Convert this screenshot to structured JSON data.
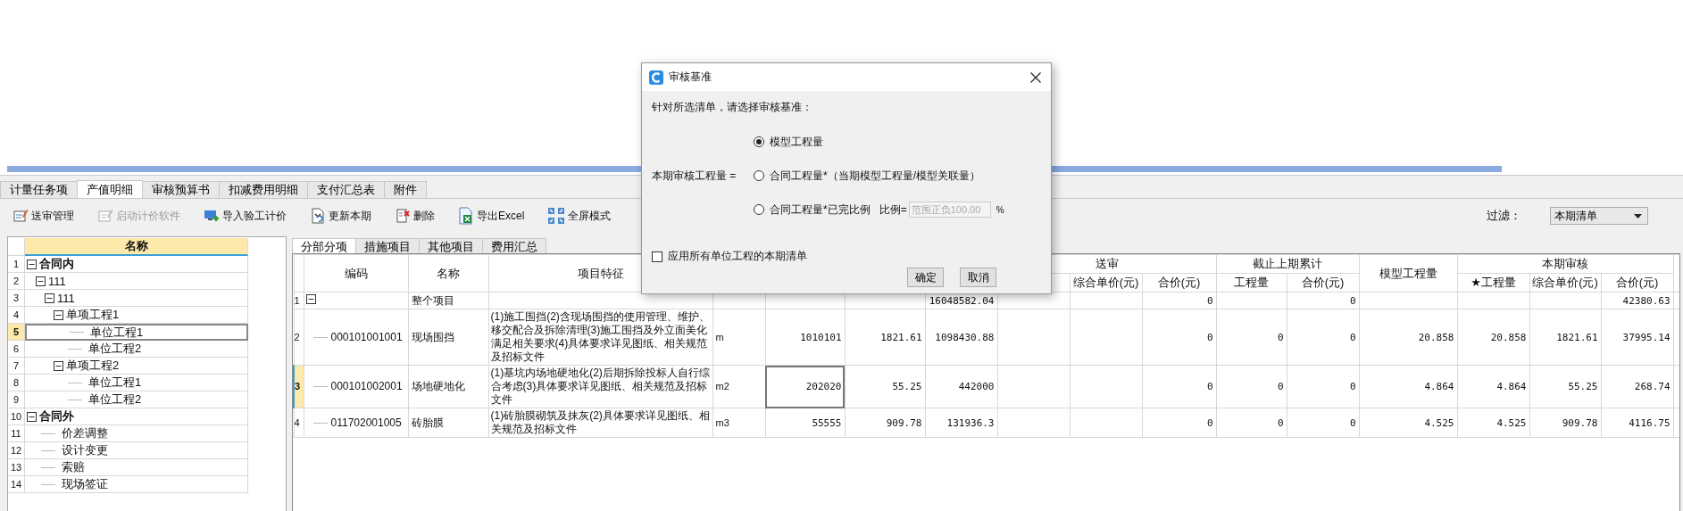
{
  "tabs": [
    {
      "label": "计量任务项",
      "selected": false
    },
    {
      "label": "产值明细",
      "selected": true
    },
    {
      "label": "审核预算书",
      "selected": false
    },
    {
      "label": "扣减费用明细",
      "selected": false
    },
    {
      "label": "支付汇总表",
      "selected": false
    },
    {
      "label": "附件",
      "selected": false
    }
  ],
  "toolbar": [
    {
      "label": "送审管理",
      "disabled": false
    },
    {
      "label": "启动计价软件",
      "disabled": true
    },
    {
      "label": "导入验工计价",
      "disabled": false
    },
    {
      "label": "更新本期",
      "disabled": false
    },
    {
      "label": "删除",
      "disabled": false
    },
    {
      "label": "导出Excel",
      "disabled": false
    },
    {
      "label": "全屏模式",
      "disabled": false
    }
  ],
  "filter": {
    "label": "过滤：",
    "value": "本期清单"
  },
  "tree": {
    "header": "名称",
    "items": [
      {
        "number": "1",
        "label": "合同内",
        "expanded": true,
        "selected": false,
        "children": [
          {
            "number": "2",
            "label": "111",
            "expanded": true,
            "selected": false,
            "children": [
              {
                "number": "3",
                "label": "111",
                "expanded": true,
                "selected": false,
                "children": [
                  {
                    "number": "4",
                    "label": "单项工程1",
                    "expanded": true,
                    "selected": false,
                    "children": [
                      {
                        "number": "5",
                        "label": "单位工程1",
                        "selected": true
                      },
                      {
                        "number": "6",
                        "label": "单位工程2",
                        "selected": false
                      }
                    ]
                  },
                  {
                    "number": "7",
                    "label": "单项工程2",
                    "expanded": true,
                    "selected": false,
                    "children": [
                      {
                        "number": "8",
                        "label": "单位工程1",
                        "selected": false
                      },
                      {
                        "number": "9",
                        "label": "单位工程2",
                        "selected": false
                      }
                    ]
                  }
                ]
              }
            ]
          }
        ]
      },
      {
        "number": "10",
        "label": "合同外",
        "expanded": true,
        "selected": false,
        "children": [
          {
            "number": "11",
            "label": "价差调整",
            "selected": false
          },
          {
            "number": "12",
            "label": "设计变更",
            "selected": false
          },
          {
            "number": "13",
            "label": "索赔",
            "selected": false
          },
          {
            "number": "14",
            "label": "现场签证",
            "selected": false
          }
        ]
      }
    ]
  },
  "subtabs": [
    {
      "label": "分部分项",
      "selected": true
    },
    {
      "label": "措施项目",
      "selected": false
    },
    {
      "label": "其他项目",
      "selected": false
    },
    {
      "label": "费用汇总",
      "selected": false
    }
  ],
  "table": {
    "columns": [
      {
        "label": "编码"
      },
      {
        "label": "名称"
      },
      {
        "label": "项目特征"
      },
      {
        "label": "送审",
        "sub": [
          "综合单价(元)",
          "合价(元)"
        ]
      },
      {
        "label": "截止上期累计",
        "sub": [
          "工程量",
          "合价(元)"
        ]
      },
      {
        "label": "模型工程量"
      },
      {
        "label": "本期审核",
        "sub": [
          "★工程量",
          "综合单价(元)",
          "合价(元)"
        ]
      }
    ],
    "rows": [
      {
        "number": "1",
        "name": "整个项目",
        "expanded": true,
        "selected": false,
        "total": "16048582.04",
        "submitted_total": "0",
        "prior_total": "0",
        "review_total": "42380.63",
        "children": [
          {
            "number": "2",
            "code": "000101001001",
            "name": "现场围挡",
            "features": "(1)施工围挡(2)含现场围挡的使用管理、维护、移交配合及拆除清理(3)施工围挡及外立面美化满足相关要求(4)具体要求详见图纸、相关规范及招标文件",
            "unit": "m",
            "quantity": "1010101",
            "unit_price": "1821.61",
            "total": "1098430.88",
            "submitted_total": "0",
            "prior_quantity": "0",
            "prior_total": "0",
            "model_quantity": "20.858",
            "review_quantity": "20.858",
            "review_unit_price": "1821.61",
            "review_total": "37995.14",
            "selected": false
          },
          {
            "number": "3",
            "code": "000101002001",
            "name": "场地硬地化",
            "features": "(1)基坑内场地硬地化(2)后期拆除投标人自行综合考虑(3)具体要求详见图纸、相关规范及招标文件",
            "unit": "m2",
            "quantity": "202020",
            "unit_price": "55.25",
            "total": "442000",
            "submitted_total": "0",
            "prior_quantity": "0",
            "prior_total": "0",
            "model_quantity": "4.864",
            "review_quantity": "4.864",
            "review_unit_price": "55.25",
            "review_total": "268.74",
            "selected": true
          },
          {
            "number": "4",
            "code": "011702001005",
            "name": "砖胎膜",
            "features": "(1)砖胎膜砌筑及抹灰(2)具体要求详见图纸、相关规范及招标文件",
            "unit": "m3",
            "quantity": "55555",
            "unit_price": "909.78",
            "total": "131936.3",
            "submitted_total": "0",
            "prior_quantity": "0",
            "prior_total": "0",
            "model_quantity": "4.525",
            "review_quantity": "4.525",
            "review_unit_price": "909.78",
            "review_total": "4116.75",
            "selected": false
          }
        ]
      }
    ]
  },
  "dialog": {
    "title": "审核基准",
    "prompt": "针对所选清单，请选择审核基准：",
    "formula_label": "本期审核工程量 =",
    "options": [
      {
        "label": "模型工程量",
        "selected": true
      },
      {
        "label": "合同工程量*（当期模型工程量/模型关联量）",
        "selected": false
      },
      {
        "label": "合同工程量*已完比例",
        "selected": false,
        "ratio": {
          "label": "比例=",
          "placeholder": "范围正负100.00",
          "unit": "%"
        }
      }
    ],
    "apply_all": {
      "label": "应用所有单位工程的本期清单",
      "checked": false
    },
    "buttons": [
      "确定",
      "取消"
    ]
  }
}
